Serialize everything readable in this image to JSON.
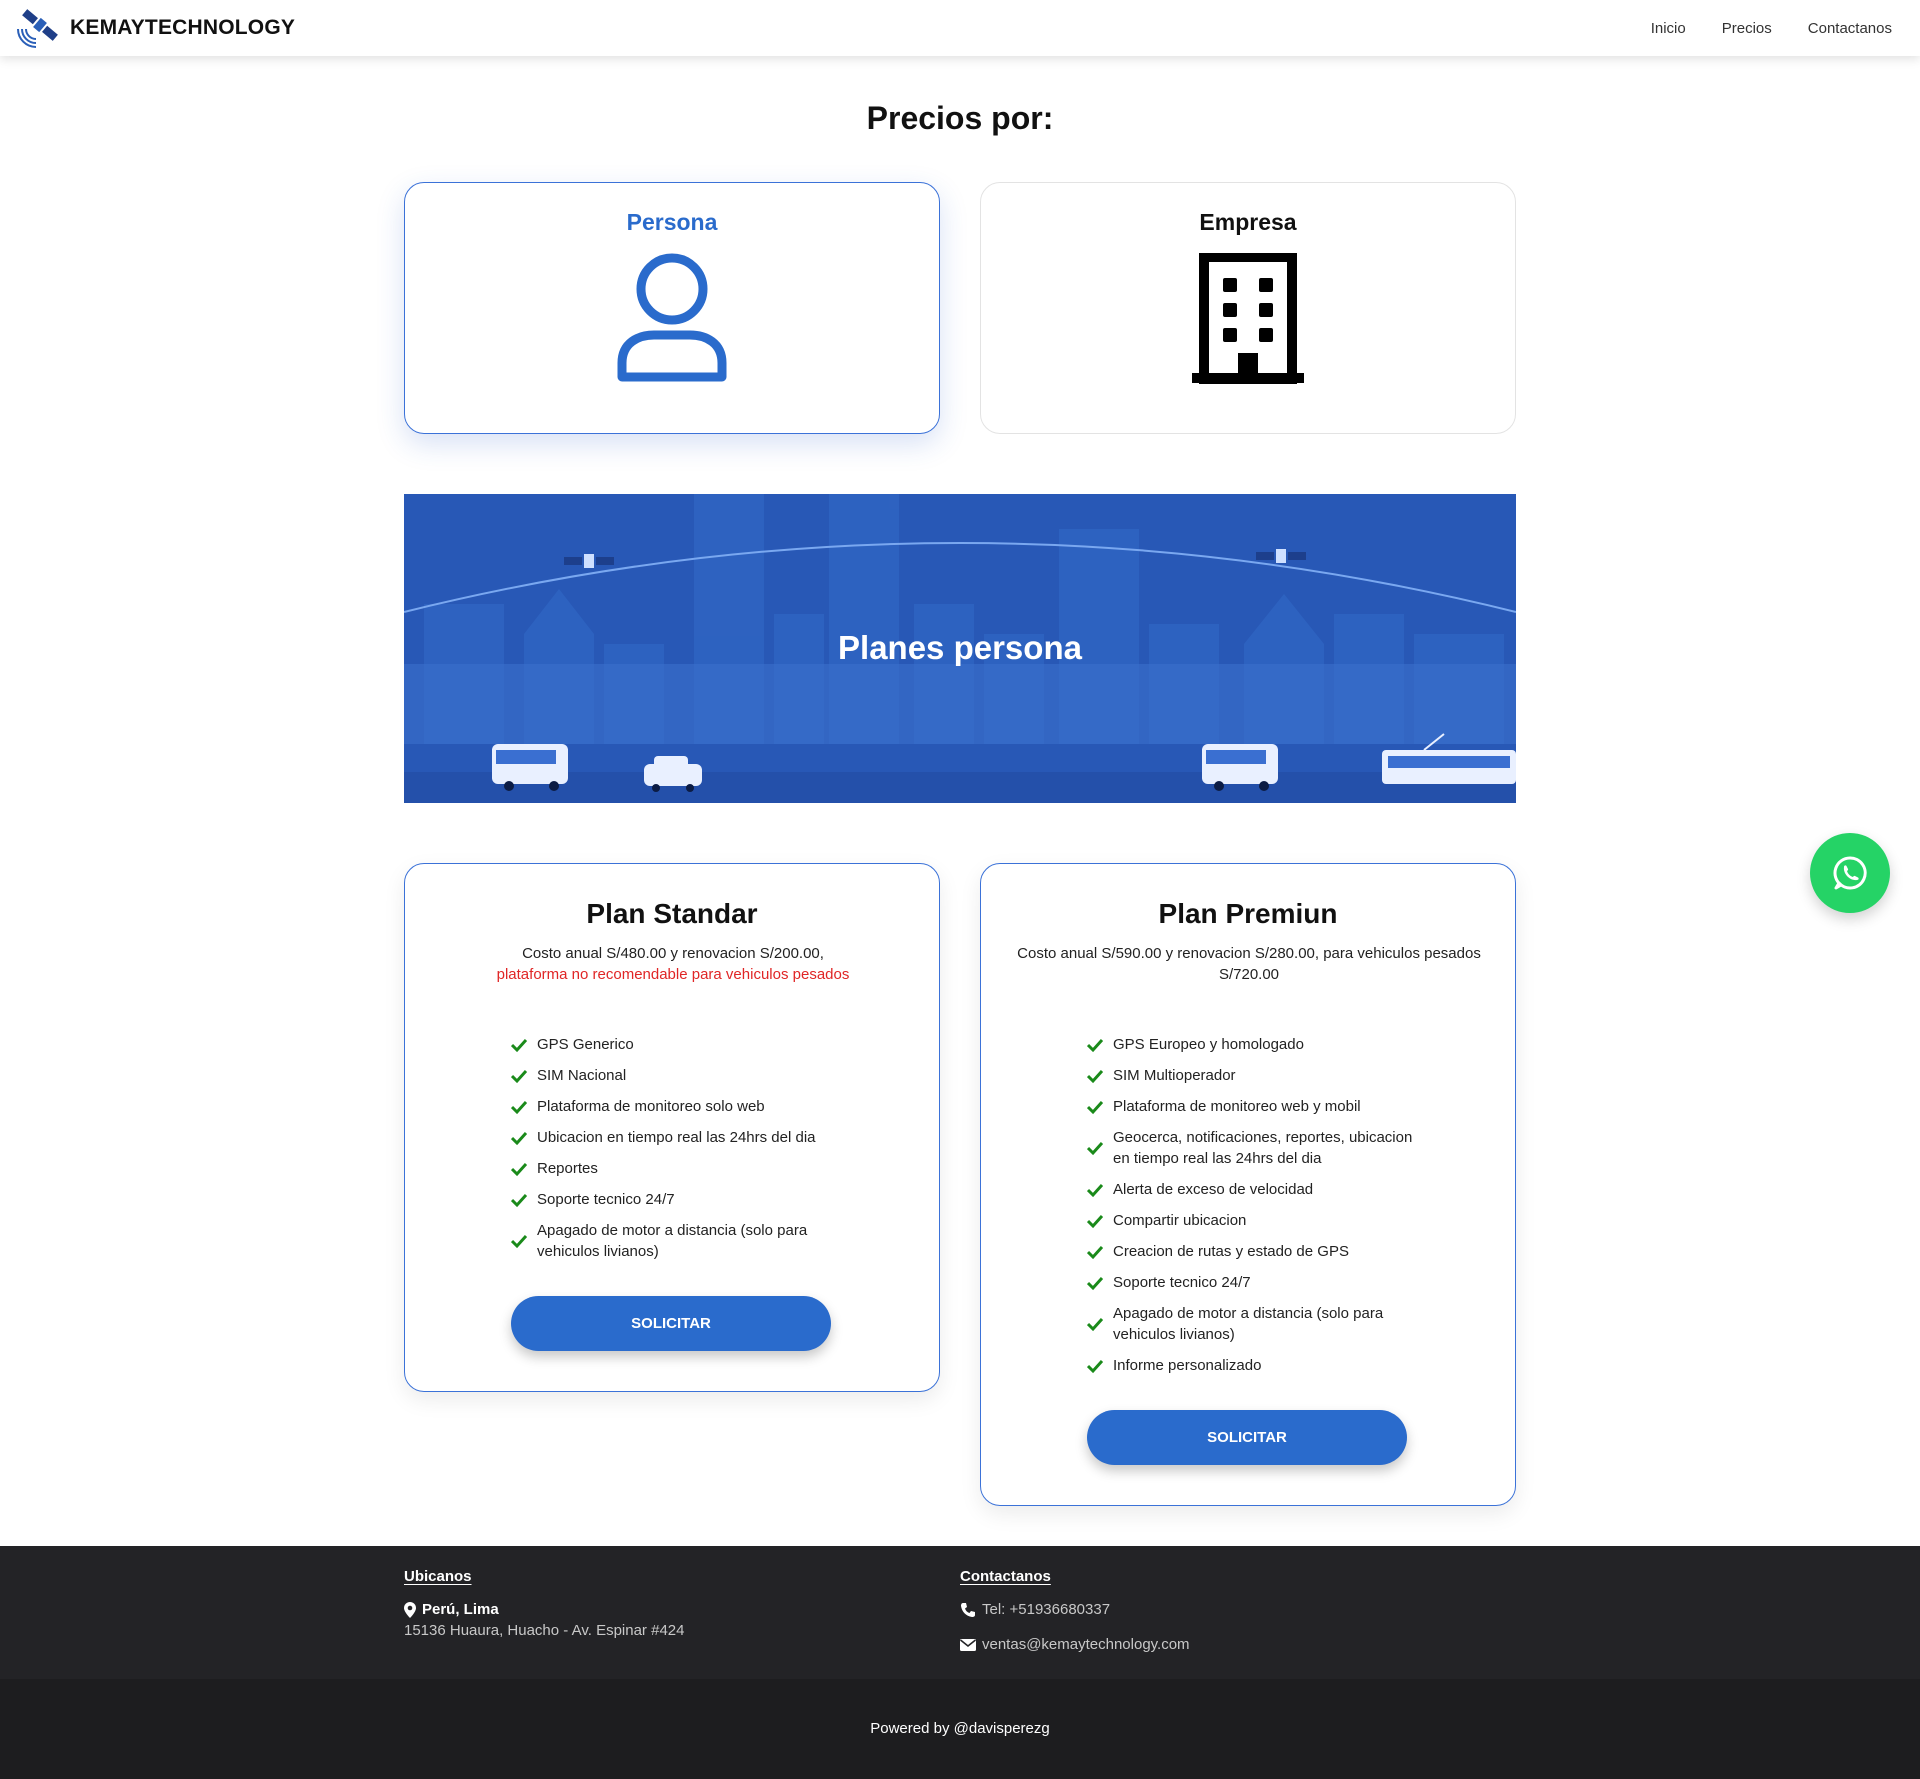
{
  "nav": {
    "brand": "KEMAYTECHNOLOGY",
    "links": [
      "Inicio",
      "Precios",
      "Contactanos"
    ]
  },
  "heading": "Precios por:",
  "choices": [
    {
      "label": "Persona",
      "icon": "person-icon"
    },
    {
      "label": "Empresa",
      "icon": "building-icon"
    }
  ],
  "banner": {
    "title": "Planes persona"
  },
  "plans": [
    {
      "title": "Plan Standar",
      "description": "Costo anual S/480.00 y renovacion S/200.00,",
      "warning": "plataforma no recomendable para vehiculos pesados",
      "features": [
        "GPS Generico",
        "SIM Nacional",
        "Plataforma de monitoreo solo web",
        "Ubicacion en tiempo real las 24hrs del dia",
        "Reportes",
        "Soporte tecnico 24/7",
        "Apagado de motor a distancia (solo para vehiculos livianos)"
      ],
      "button": "SOLICITAR"
    },
    {
      "title": "Plan Premiun",
      "description": "Costo anual S/590.00 y renovacion S/280.00, para vehiculos pesados S/720.00",
      "features": [
        "GPS Europeo y homologado",
        "SIM Multioperador",
        "Plataforma de monitoreo web y mobil",
        "Geocerca, notificaciones, reportes, ubicacion en tiempo real las 24hrs del dia",
        "Alerta de exceso de velocidad",
        "Compartir ubicacion",
        "Creacion de rutas y estado de GPS",
        "Soporte tecnico 24/7",
        "Apagado de motor a distancia (solo para vehiculos livianos)",
        "Informe personalizado"
      ],
      "button": "SOLICITAR"
    }
  ],
  "footer": {
    "ubicanos": {
      "heading": "Ubicanos",
      "place": "Perú, Lima",
      "address": "15136 Huaura, Huacho - Av. Espinar #424"
    },
    "contactanos": {
      "heading": "Contactanos",
      "phone": "Tel: +51936680337",
      "email": "ventas@kemaytechnology.com"
    },
    "powered": "Powered by @davisperezg"
  },
  "colors": {
    "accent": "#2a6bcc",
    "banner": "#2858b6",
    "whatsapp": "#25d366",
    "warning": "#e02626",
    "check": "#1a8a1a",
    "footer": "#232326"
  }
}
